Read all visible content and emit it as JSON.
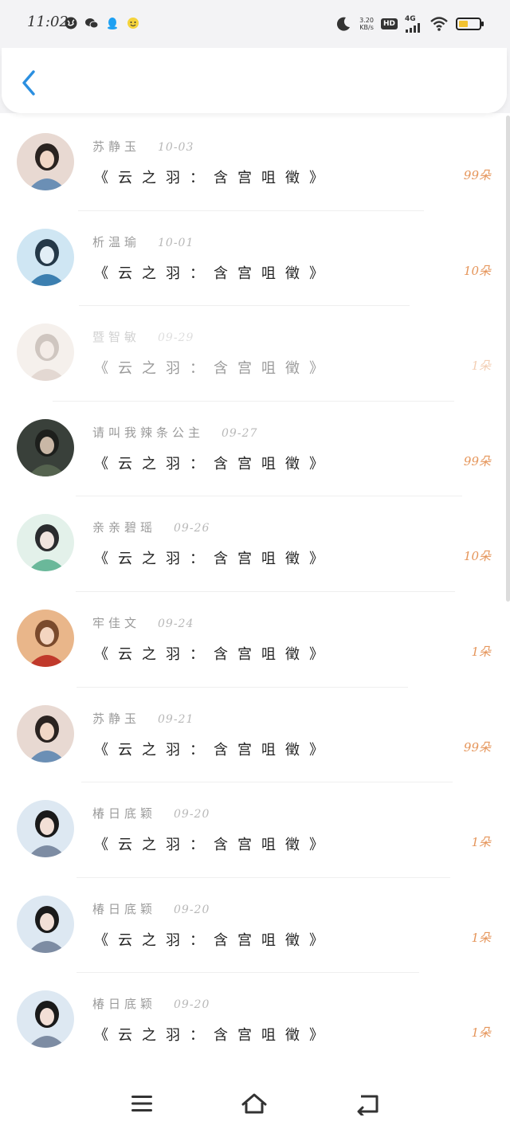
{
  "status_bar": {
    "time": "11:02",
    "net_speed_value": "3.20",
    "net_speed_unit": "KB/s",
    "hd_label": "HD",
    "network_label": "4G"
  },
  "header": {
    "back_icon": "chevron-left-icon"
  },
  "colors": {
    "accent_blue": "#2b8fe0",
    "count_orange": "#e5955a"
  },
  "messages": [
    {
      "name": "苏静玉",
      "date": "10-03",
      "title": "《云之羽：含宫咀徵》",
      "count": "99朵",
      "faded": false
    },
    {
      "name": "析温瑜",
      "date": "10-01",
      "title": "《云之羽：含宫咀徵》",
      "count": "10朵",
      "faded": false
    },
    {
      "name": "暨智敏",
      "date": "09-29",
      "title": "《云之羽：含宫咀徵》",
      "count": "1朵",
      "faded": true
    },
    {
      "name": "请叫我辣条公主",
      "date": "09-27",
      "title": "《云之羽：含宫咀徵》",
      "count": "99朵",
      "faded": false
    },
    {
      "name": "亲亲碧瑶",
      "date": "09-26",
      "title": "《云之羽：含宫咀徵》",
      "count": "10朵",
      "faded": false
    },
    {
      "name": "牢佳文",
      "date": "09-24",
      "title": "《云之羽：含宫咀徵》",
      "count": "1朵",
      "faded": false
    },
    {
      "name": "苏静玉",
      "date": "09-21",
      "title": "《云之羽：含宫咀徵》",
      "count": "99朵",
      "faded": false
    },
    {
      "name": "椿日底颖",
      "date": "09-20",
      "title": "《云之羽：含宫咀徵》",
      "count": "1朵",
      "faded": false
    },
    {
      "name": "椿日底颖",
      "date": "09-20",
      "title": "《云之羽：含宫咀徵》",
      "count": "1朵",
      "faded": false
    },
    {
      "name": "椿日底颖",
      "date": "09-20",
      "title": "《云之羽：含宫咀徵》",
      "count": "1朵",
      "faded": false
    }
  ],
  "nav_bar": {
    "menu_icon": "menu-icon",
    "home_icon": "home-icon",
    "back_icon": "back-icon"
  }
}
